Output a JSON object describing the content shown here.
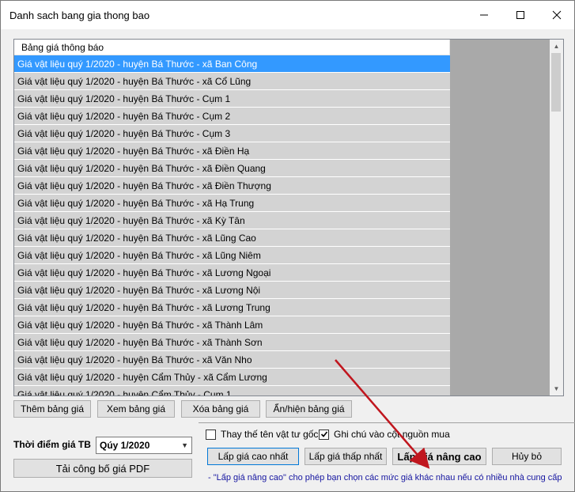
{
  "window": {
    "title": "Danh sach bang gia thong bao"
  },
  "list": {
    "header": "Bảng giá thông báo",
    "rows": [
      "Giá vật liệu quý 1/2020 - huyện Bá Thước - xã Ban Công",
      "Giá vật liệu quý 1/2020 - huyện Bá Thước - xã Cổ Lũng",
      "Giá vật liệu quý 1/2020 - huyện Bá Thước - Cụm 1",
      "Giá vật liệu quý 1/2020 - huyện Bá Thước - Cụm 2",
      "Giá vật liệu quý 1/2020 - huyện Bá Thước - Cụm 3",
      "Giá vật liệu quý 1/2020 - huyện Bá Thước - xã Điền Hạ",
      "Giá vật liệu quý 1/2020 - huyện Bá Thước - xã Điền Quang",
      "Giá vật liệu quý 1/2020 - huyện Bá Thước - xã Điền Thượng",
      "Giá vật liệu quý 1/2020 - huyện Bá Thước - xã Hạ Trung",
      "Giá vật liệu quý 1/2020 - huyện Bá Thước - xã Kỳ Tân",
      "Giá vật liệu quý 1/2020 - huyện Bá Thước - xã Lũng Cao",
      "Giá vật liệu quý 1/2020 - huyện Bá Thước - xã Lũng Niêm",
      "Giá vật liệu quý 1/2020 - huyện Bá Thước - xã Lương Ngoại",
      "Giá vật liệu quý 1/2020 - huyện Bá Thước - xã Lương Nội",
      "Giá vật liệu quý 1/2020 - huyện Bá Thước - xã Lương Trung",
      "Giá vật liệu quý 1/2020 - huyện Bá Thước - xã Thành Lâm",
      "Giá vật liệu quý 1/2020 - huyện Bá Thước - xã Thành Sơn",
      "Giá vật liệu quý 1/2020 - huyện Bá Thước - xã Văn Nho",
      "Giá vật liệu quý 1/2020 - huyện Cẩm Thủy - xã Cẩm Lương",
      "Giá vật liệu quý 1/2020 - huyện Cẩm Thủy - Cụm 1"
    ],
    "selected_index": 0
  },
  "list_buttons": {
    "add": "Thêm bảng giá",
    "view": "Xem bảng giá",
    "delete": "Xóa bảng giá",
    "toggle": "Ẩn/hiện bảng giá"
  },
  "time": {
    "label": "Thời điểm giá TB",
    "selected": "Qúy 1/2020"
  },
  "download_pdf": "Tải công bố giá PDF",
  "options": {
    "replace_name": {
      "label": "Thay thế tên vật tư gốc",
      "checked": false
    },
    "note_source": {
      "label": "Ghi chú vào cột nguồn mua",
      "checked": true
    }
  },
  "actions": {
    "highest": "Lấp giá cao nhất",
    "lowest": "Lấp giá thấp nhất",
    "advanced": "Lấp giá nâng cao",
    "cancel": "Hủy bỏ"
  },
  "note": "- \"Lấp giá nâng cao\" cho phép bạn chọn các mức giá khác nhau nếu có nhiều nhà cung cấp",
  "colors": {
    "selection": "#3399ff",
    "annotation_arrow": "#c0161e",
    "note_text": "#1515a0"
  }
}
